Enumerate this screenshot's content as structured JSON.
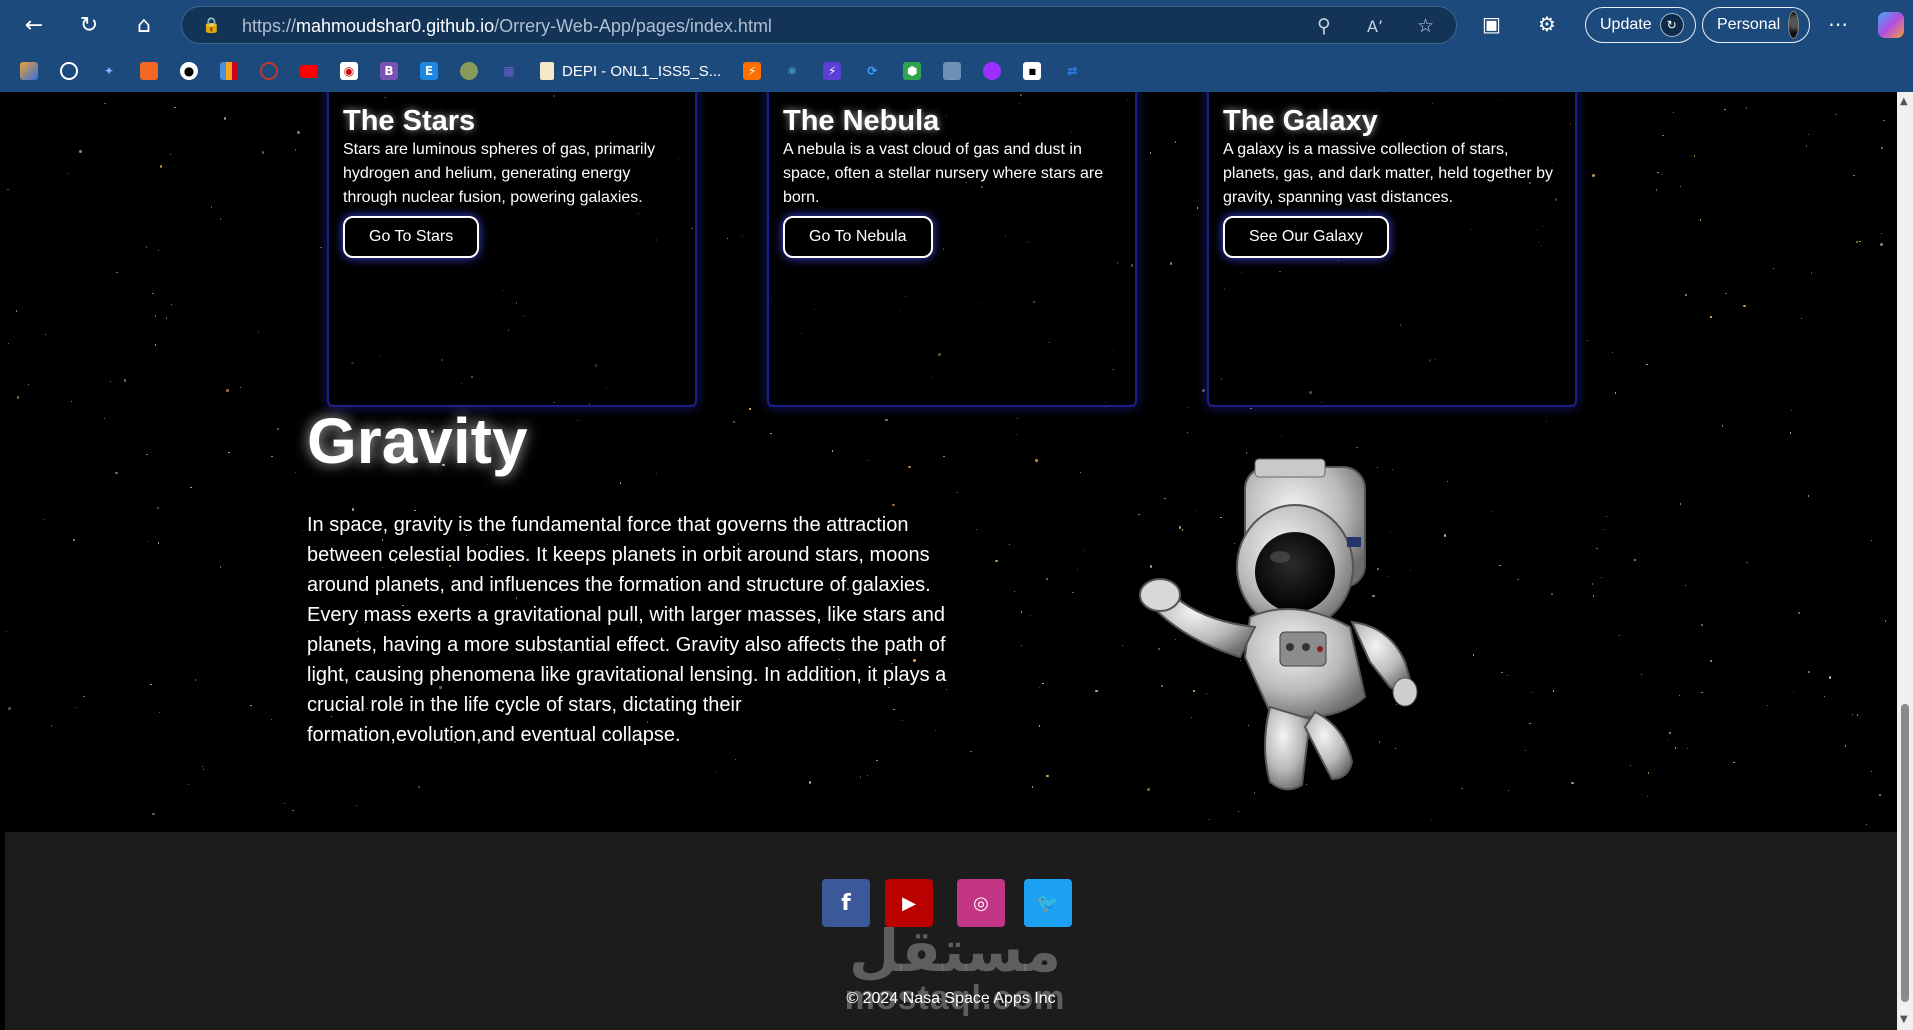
{
  "browser": {
    "url_prefix": "https://",
    "url_host": "mahmoudshar0.github.io",
    "url_path": "/Orrery-Web-App/pages/index.html",
    "update_label": "Update",
    "profile_label": "Personal",
    "bookmark_folder_label": "DEPI - ONL1_ISS5_S...",
    "icons": [
      "back-icon",
      "refresh-icon",
      "home-icon",
      "lock-icon",
      "zoom-icon",
      "read-aloud-icon",
      "favorite-star-icon",
      "collections-icon",
      "extensions-icon",
      "more-icon",
      "copilot-icon"
    ]
  },
  "cards": [
    {
      "title": "The Stars",
      "text": "Stars are luminous spheres of gas, primarily hydrogen and helium, generating energy through nuclear fusion, powering galaxies.",
      "button": "Go To Stars"
    },
    {
      "title": "The Nebula",
      "text": "A nebula is a vast cloud of gas and dust in space, often a stellar nursery where stars are born.",
      "button": "Go To Nebula"
    },
    {
      "title": "The Galaxy",
      "text": "A galaxy is a massive collection of stars, planets, gas, and dark matter, held together by gravity, spanning vast distances.",
      "button": "See Our Galaxy"
    }
  ],
  "gravity": {
    "title": "Gravity",
    "text": "In space, gravity is the fundamental force that governs the attraction between celestial bodies. It keeps planets in orbit around stars, moons around planets, and influences the formation and structure of galaxies. Every mass exerts a gravitational pull, with larger masses, like stars and planets, having a more substantial effect. Gravity also affects the path of light, causing phenomena like gravitational lensing. In addition, it plays a crucial role in the life cycle of stars, dictating their formation,evolution,and eventual collapse."
  },
  "footer": {
    "social": [
      {
        "name": "facebook",
        "glyph": "f",
        "color": "#3b5998"
      },
      {
        "name": "youtube",
        "glyph": "▶",
        "color": "#bb0000"
      },
      {
        "name": "instagram",
        "glyph": "◎",
        "color": "#c13584"
      },
      {
        "name": "twitter",
        "glyph": "🐦",
        "color": "#1da1f2"
      }
    ],
    "watermark_arabic": "مستقل",
    "watermark_latin": "mostaql.com",
    "copyright": "© 2024 Nasa Space Apps Inc"
  }
}
